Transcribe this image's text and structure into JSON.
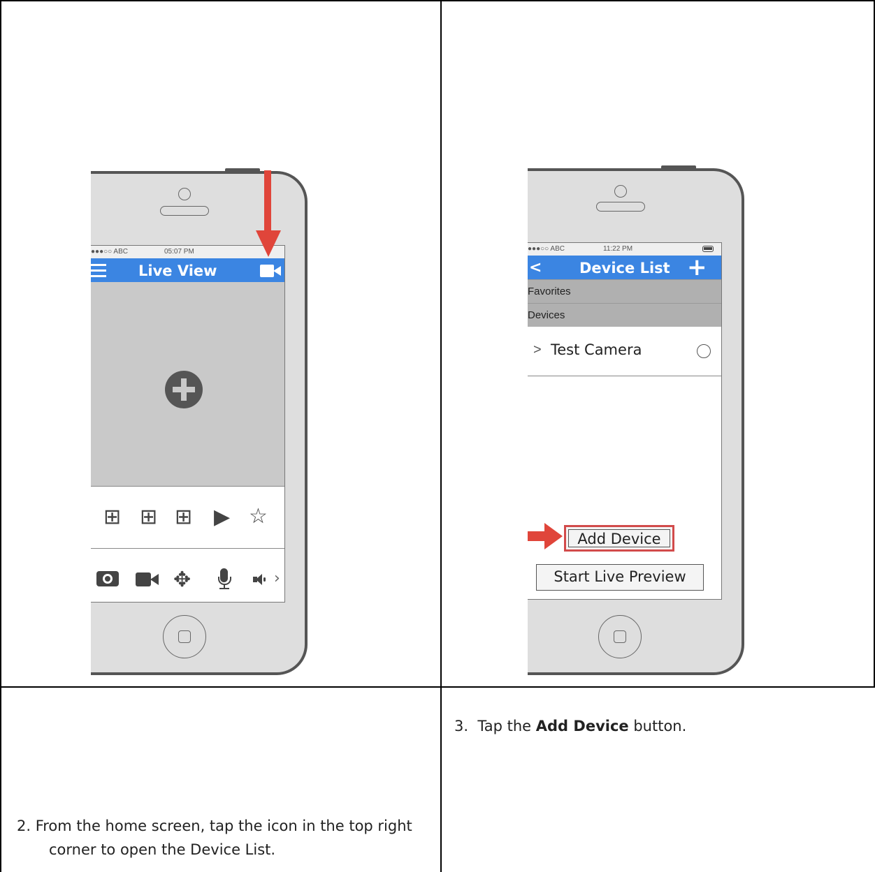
{
  "left_panel": {
    "status": {
      "carrier": "●●●○○ ABC",
      "time": "05:07 PM"
    },
    "nav": {
      "menu_icon": "hamburger-menu-icon",
      "title": "Live View",
      "action_icon": "video-camera-icon"
    },
    "main": {
      "add_icon": "plus-circle-icon"
    },
    "toolbar1": [
      {
        "name": "grid-add-icon-1",
        "glyph": "⊞"
      },
      {
        "name": "grid-add-icon-2",
        "glyph": "⊞"
      },
      {
        "name": "grid-add-icon-3",
        "glyph": "⊞"
      },
      {
        "name": "play-icon",
        "glyph": "▶"
      },
      {
        "name": "star-icon",
        "glyph": "☆"
      }
    ],
    "toolbar2": [
      {
        "name": "camera-icon",
        "glyph": "📷"
      },
      {
        "name": "video-record-icon",
        "glyph": "■◀"
      },
      {
        "name": "move-arrows-icon",
        "glyph": "✥"
      },
      {
        "name": "microphone-icon",
        "glyph": "🎙"
      },
      {
        "name": "speaker-icon",
        "glyph": "◀)"
      },
      {
        "name": "chevron-right-icon",
        "glyph": "›"
      }
    ],
    "arrow_color": "#e0453a"
  },
  "right_panel": {
    "status": {
      "carrier": "●●●○○ ABC",
      "time": "11:22 PM"
    },
    "nav": {
      "back_glyph": "<",
      "title": "Device List",
      "add_glyph": "+"
    },
    "sections": {
      "favorites": "Favorites",
      "devices": "Devices"
    },
    "device": {
      "chevron": ">",
      "name": "Test Camera"
    },
    "buttons": {
      "add_device": "Add Device",
      "start_live_preview": "Start Live Preview"
    },
    "highlight_color": "#d24b4b"
  },
  "captions": {
    "step2_line1": "2.  From the home screen, tap the icon in the top right",
    "step2_line2": "corner to open the Device List.",
    "step3_prefix": "3.  Tap the ",
    "step3_bold": "Add Device",
    "step3_suffix": " button."
  }
}
